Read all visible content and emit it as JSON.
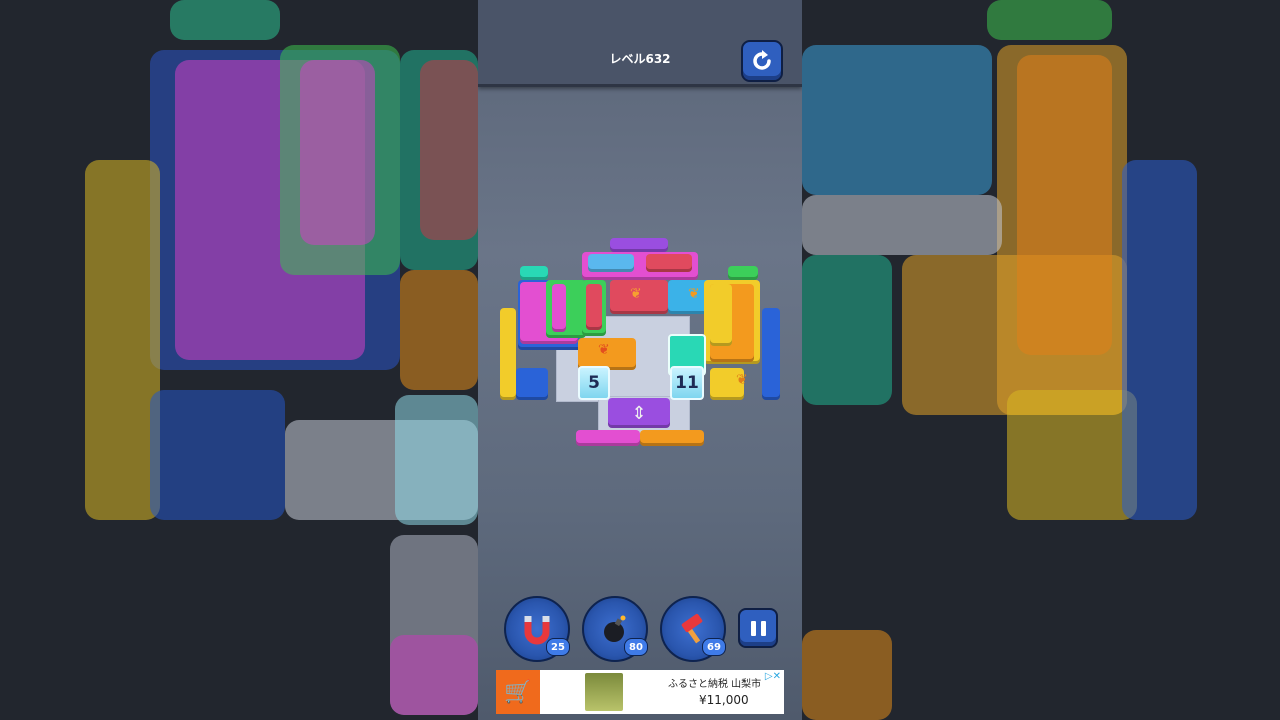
{
  "header": {
    "level_label": "レベル632",
    "restart_icon": "restart-icon"
  },
  "board": {
    "number_cells": [
      {
        "value": "5"
      },
      {
        "value": "11"
      }
    ],
    "icons": [
      "maple-leaf-icon",
      "arrow-updown-icon"
    ]
  },
  "tools": [
    {
      "name": "magnet",
      "icon": "magnet-icon",
      "count": "25"
    },
    {
      "name": "bomb",
      "icon": "bomb-icon",
      "count": "80"
    },
    {
      "name": "hammer",
      "icon": "hammer-icon",
      "count": "69"
    }
  ],
  "pause": {
    "icon": "pause-icon"
  },
  "ad": {
    "title": "ふるさと納税 山梨市",
    "price": "¥11,000",
    "choice": "▷✕"
  },
  "colors": {
    "magenta": "#e34fd1",
    "purple": "#9a4ee0",
    "red": "#e04a5e",
    "cyan": "#3bb2e8",
    "teal": "#29d8b5",
    "orange": "#f39a1e",
    "yellow": "#f2cc2a",
    "blue": "#2a63d8",
    "green": "#3ccf5a"
  }
}
